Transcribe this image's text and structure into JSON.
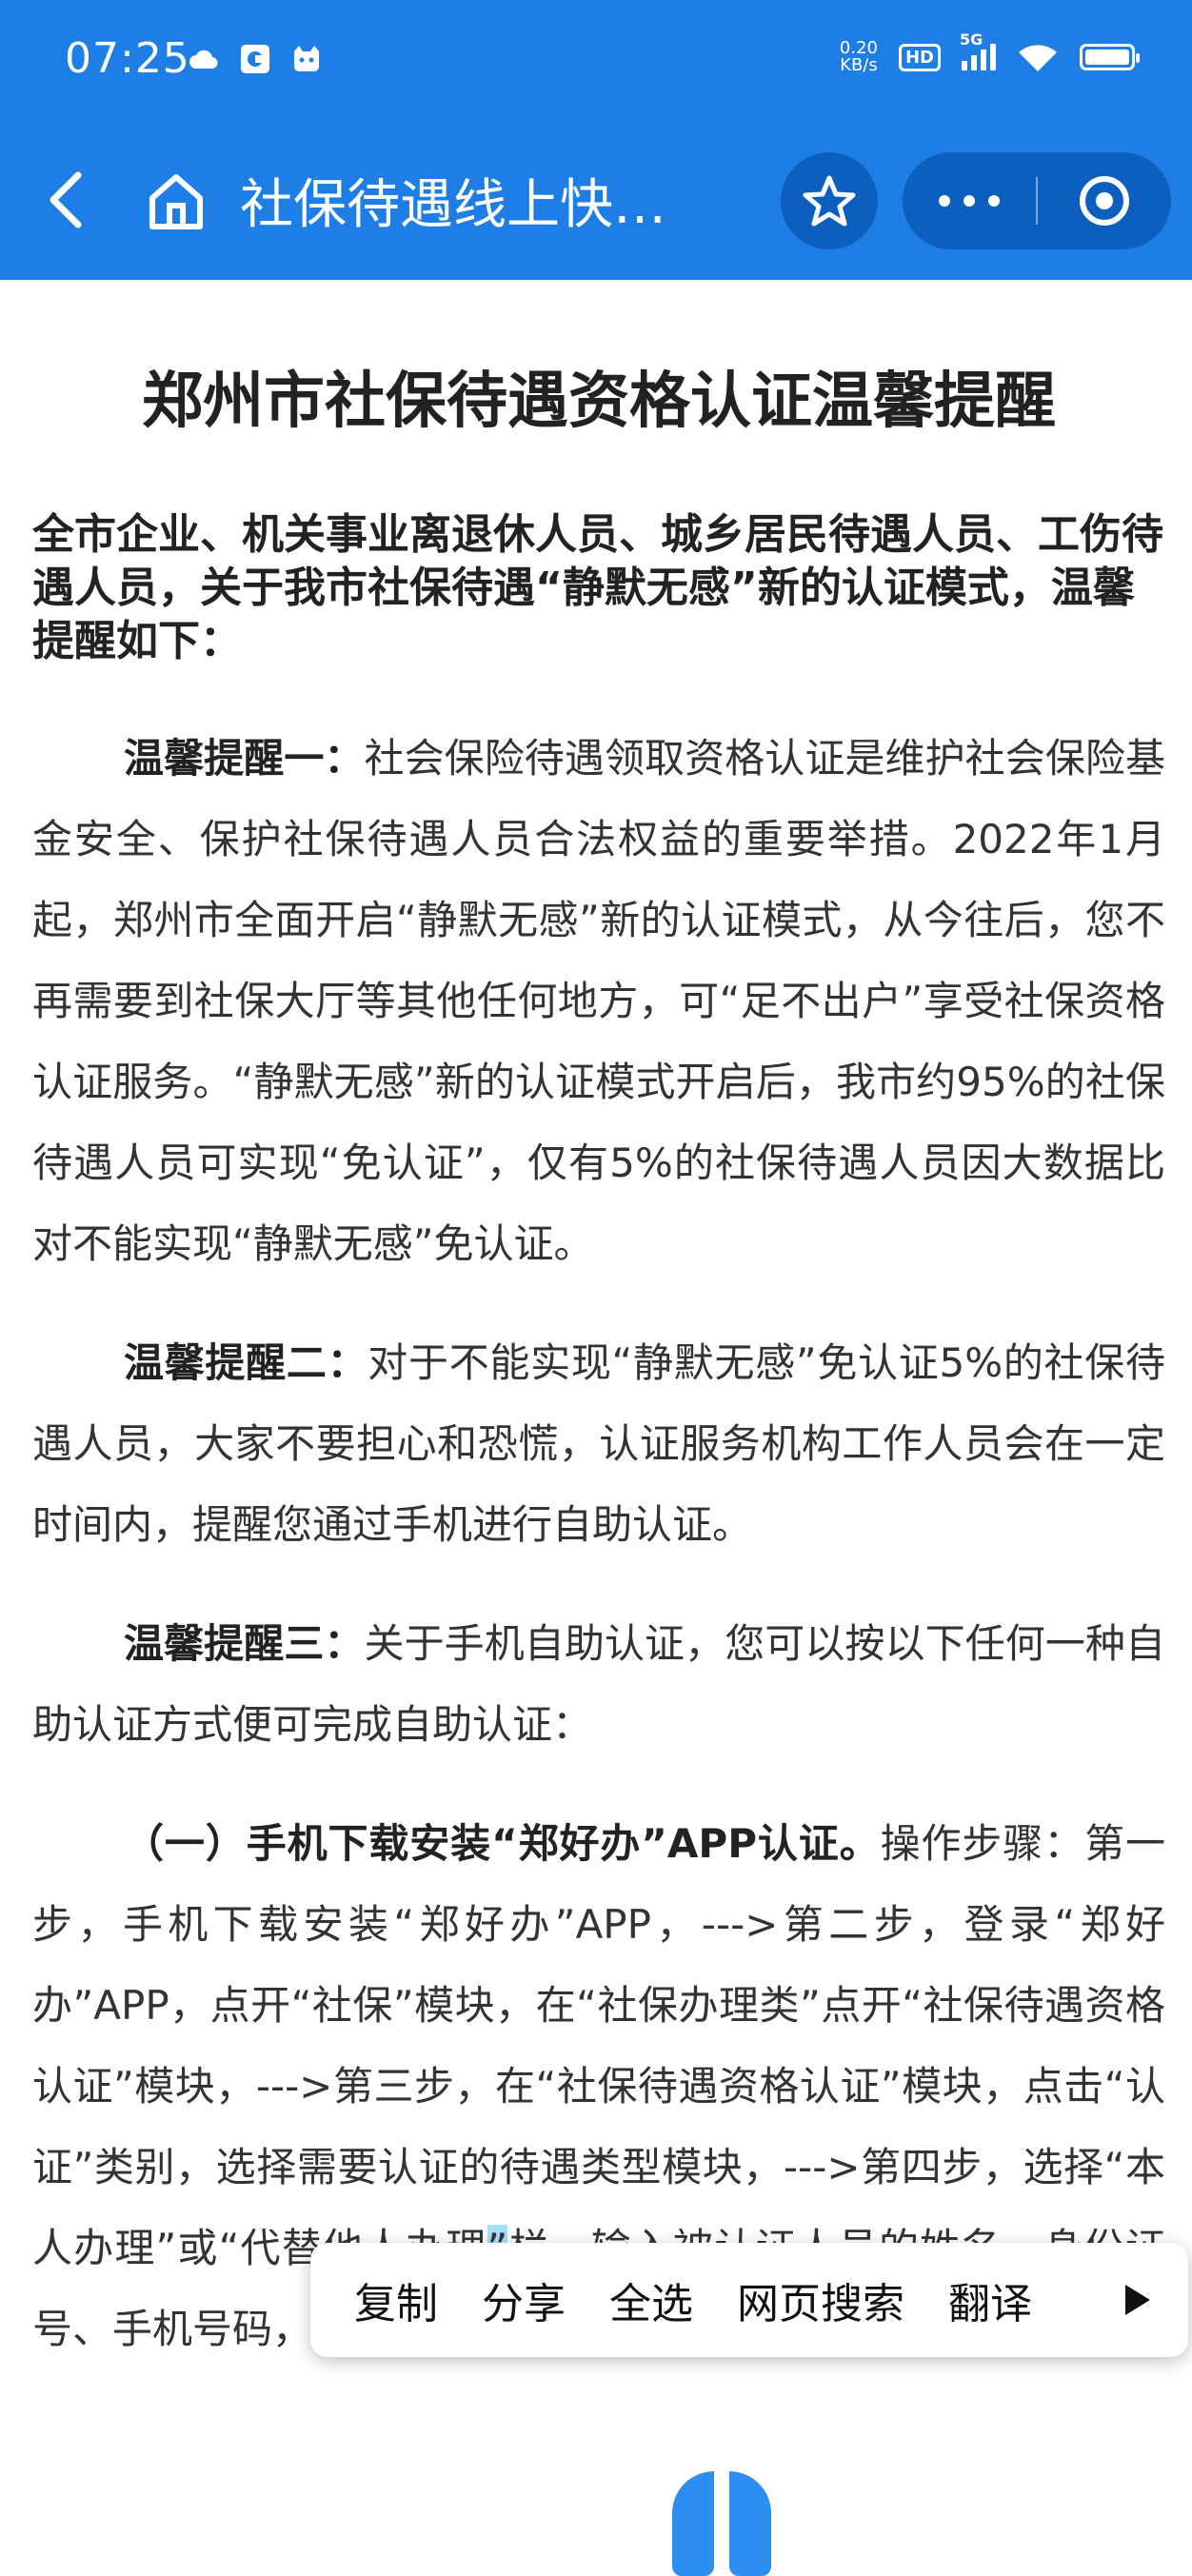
{
  "status_bar": {
    "time": "07:25",
    "net_speed_value": "0.20",
    "net_speed_unit": "KB/s",
    "hd_badge": "HD",
    "network": "5G"
  },
  "nav": {
    "title": "社保待遇线上快…"
  },
  "article": {
    "headline": "郑州市社保待遇资格认证温馨提醒",
    "intro": "全市企业、机关事业离退休人员、城乡居民待遇人员、工伤待遇人员，关于我市社保待遇“静默无感”新的认证模式，温馨提醒如下：",
    "p1_lead": "温馨提醒一：",
    "p1_text": "社会保险待遇领取资格认证是维护社会保险基金安全、保护社保待遇人员合法权益的重要举措。2022年1月起，郑州市全面开启“静默无感”新的认证模式，从今往后，您不再需要到社保大厅等其他任何地方，可“足不出户”享受社保资格认证服务。“静默无感”新的认证模式开启后，我市约95%的社保待遇人员可实现“免认证”，仅有5%的社保待遇人员因大数据比对不能实现“静默无感”免认证。",
    "p2_lead": "温馨提醒二：",
    "p2_text": "对于不能实现“静默无感”免认证5%的社保待遇人员，大家不要担心和恐慌，认证服务机构工作人员会在一定时间内，提醒您通过手机进行自助认证。",
    "p3_lead": "温馨提醒三：",
    "p3_text": "关于手机自助认证，您可以按以下任何一种自助认证方式便可完成自助认证：",
    "p4_lead": "（一）手机下载安装“郑好办”APP认证。",
    "p4_text_a": "操作步骤：第一步，手机下载安装“郑好办”APP，--->第二步，登录“郑好办”APP，点开“社保”模块，在“社保办理类”点开“社保待遇资格认证”模块，--->第三步，在“社保待遇资格认证”模块，点击“认证”类别，选择需要认证的待遇类型模块，--->第四步，选择“本人办理”或“代替他人办理",
    "p4_selected": "”",
    "p4_text_b": "栏，输入被认证人员的姓名、身份证号、手机号码，--->点击“前往验证”，"
  },
  "context_menu": {
    "copy": "复制",
    "share": "分享",
    "select_all": "全选",
    "web_search": "网页搜索",
    "translate": "翻译"
  }
}
